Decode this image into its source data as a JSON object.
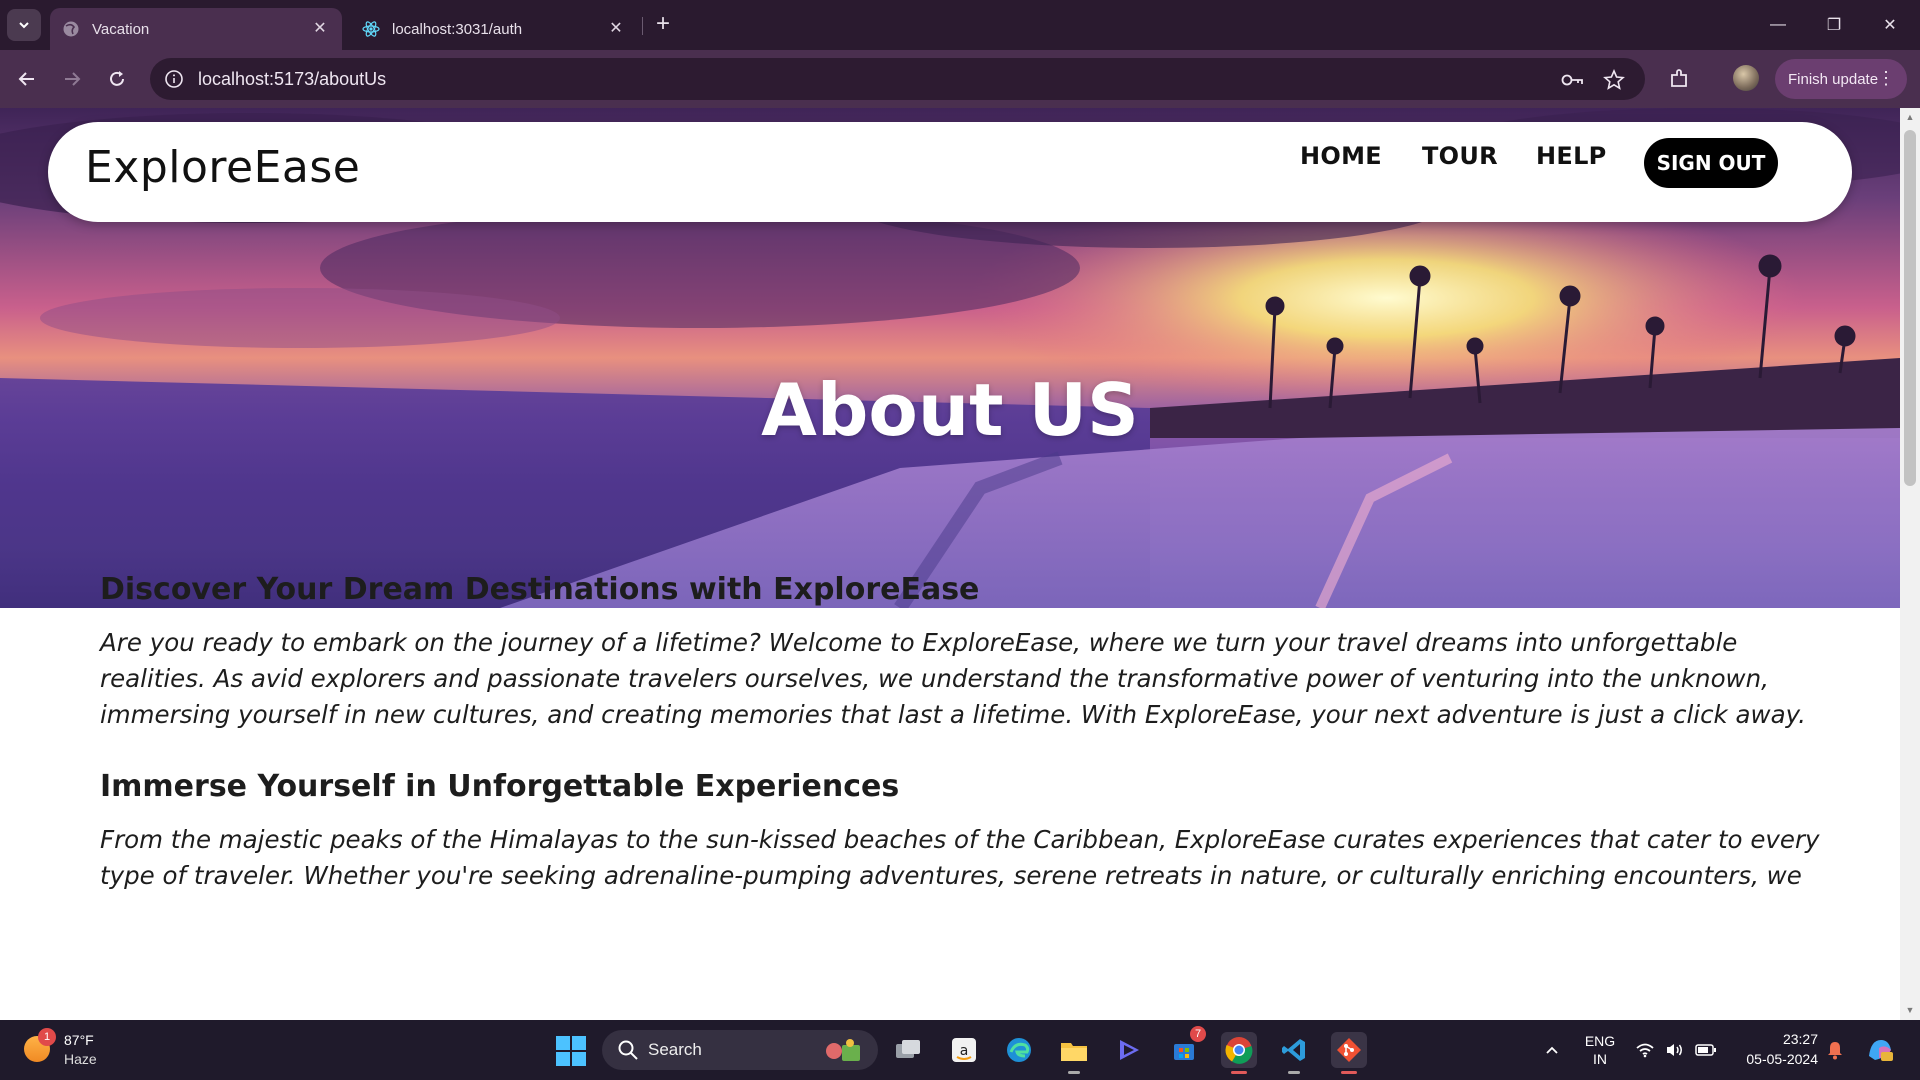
{
  "browser": {
    "tabs": [
      {
        "title": "Vacation",
        "active": true
      },
      {
        "title": "localhost:3031/auth",
        "active": false
      }
    ],
    "url": "localhost:5173/aboutUs",
    "finish_update_label": "Finish update"
  },
  "site": {
    "brand": "ExploreEase",
    "nav": {
      "home": "HOME",
      "tour": "TOUR",
      "help": "HELP",
      "sign_out": "SIGN OUT"
    },
    "hero_title": "About US",
    "sections": [
      {
        "heading": "Discover Your Dream Destinations with ExploreEase",
        "body": "Are you ready to embark on the journey of a lifetime? Welcome to ExploreEase, where we turn your travel dreams into unforgettable realities. As avid explorers and passionate travelers ourselves, we understand the transformative power of venturing into the unknown, immersing yourself in new cultures, and creating memories that last a lifetime. With ExploreEase, your next adventure is just a click away."
      },
      {
        "heading": "Immerse Yourself in Unforgettable Experiences",
        "body": "From the majestic peaks of the Himalayas to the sun-kissed beaches of the Caribbean, ExploreEase curates experiences that cater to every type of traveler. Whether you're seeking adrenaline-pumping adventures, serene retreats in nature, or culturally enriching encounters, we"
      }
    ]
  },
  "taskbar": {
    "weather": {
      "temp": "87°F",
      "condition": "Haze",
      "badge": "1"
    },
    "search_label": "Search",
    "store_badge": "7",
    "lang": {
      "line1": "ENG",
      "line2": "IN"
    },
    "time": "23:27",
    "date": "05-05-2024"
  },
  "colors": {
    "tab_bar": "#2a1a2f",
    "toolbar": "#4a2f4f",
    "taskbar": "#1f1a2b",
    "signout_bg": "#000000"
  }
}
